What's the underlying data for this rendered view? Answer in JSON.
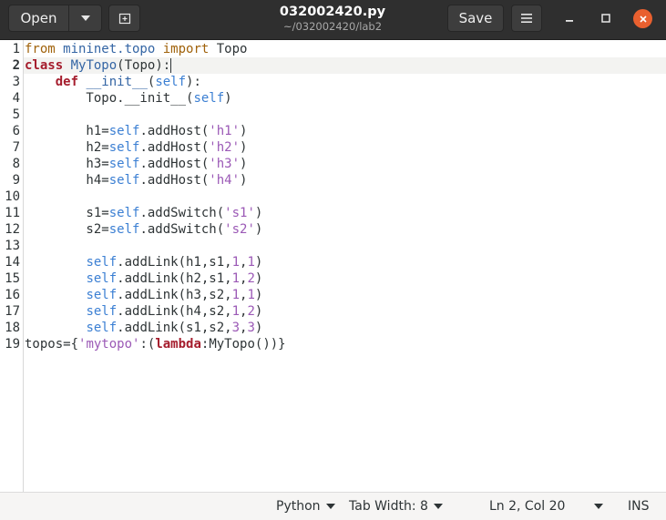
{
  "header": {
    "open_label": "Open",
    "save_label": "Save",
    "title": "032002420.py",
    "subtitle": "~/032002420/lab2"
  },
  "editor": {
    "lines": [
      {
        "n": "1",
        "tokens": [
          [
            "kw-imp",
            "from"
          ],
          [
            "",
            ""
          ],
          [
            "def-name",
            " mininet.topo"
          ],
          [
            "",
            ""
          ],
          [
            "kw-imp",
            " import"
          ],
          [
            "",
            " Topo"
          ]
        ]
      },
      {
        "n": "2",
        "tokens": [
          [
            "kw",
            "class"
          ],
          [
            "",
            " "
          ],
          [
            "def-name",
            "MyTopo"
          ],
          [
            "",
            "(Topo):"
          ]
        ]
      },
      {
        "n": "3",
        "tokens": [
          [
            "",
            "    "
          ],
          [
            "kw",
            "def"
          ],
          [
            "",
            " "
          ],
          [
            "def-name",
            "__init__"
          ],
          [
            "",
            "("
          ],
          [
            "self",
            "self"
          ],
          [
            "",
            "):"
          ]
        ]
      },
      {
        "n": "4",
        "tokens": [
          [
            "",
            "        Topo.__init__("
          ],
          [
            "self",
            "self"
          ],
          [
            "",
            ")"
          ]
        ]
      },
      {
        "n": "5",
        "tokens": []
      },
      {
        "n": "6",
        "tokens": [
          [
            "",
            "        h1="
          ],
          [
            "self",
            "self"
          ],
          [
            "",
            ".addHost("
          ],
          [
            "str",
            "'h1'"
          ],
          [
            "",
            ")"
          ]
        ]
      },
      {
        "n": "7",
        "tokens": [
          [
            "",
            "        h2="
          ],
          [
            "self",
            "self"
          ],
          [
            "",
            ".addHost("
          ],
          [
            "str",
            "'h2'"
          ],
          [
            "",
            ")"
          ]
        ]
      },
      {
        "n": "8",
        "tokens": [
          [
            "",
            "        h3="
          ],
          [
            "self",
            "self"
          ],
          [
            "",
            ".addHost("
          ],
          [
            "str",
            "'h3'"
          ],
          [
            "",
            ")"
          ]
        ]
      },
      {
        "n": "9",
        "tokens": [
          [
            "",
            "        h4="
          ],
          [
            "self",
            "self"
          ],
          [
            "",
            ".addHost("
          ],
          [
            "str",
            "'h4'"
          ],
          [
            "",
            ")"
          ]
        ]
      },
      {
        "n": "10",
        "tokens": []
      },
      {
        "n": "11",
        "tokens": [
          [
            "",
            "        s1="
          ],
          [
            "self",
            "self"
          ],
          [
            "",
            ".addSwitch("
          ],
          [
            "str",
            "'s1'"
          ],
          [
            "",
            ")"
          ]
        ]
      },
      {
        "n": "12",
        "tokens": [
          [
            "",
            "        s2="
          ],
          [
            "self",
            "self"
          ],
          [
            "",
            ".addSwitch("
          ],
          [
            "str",
            "'s2'"
          ],
          [
            "",
            ")"
          ]
        ]
      },
      {
        "n": "13",
        "tokens": []
      },
      {
        "n": "14",
        "tokens": [
          [
            "",
            "        "
          ],
          [
            "self",
            "self"
          ],
          [
            "",
            ".addLink(h1,s1,"
          ],
          [
            "num",
            "1"
          ],
          [
            "",
            ","
          ],
          [
            "num",
            "1"
          ],
          [
            "",
            ")"
          ]
        ]
      },
      {
        "n": "15",
        "tokens": [
          [
            "",
            "        "
          ],
          [
            "self",
            "self"
          ],
          [
            "",
            ".addLink(h2,s1,"
          ],
          [
            "num",
            "1"
          ],
          [
            "",
            ","
          ],
          [
            "num",
            "2"
          ],
          [
            "",
            ")"
          ]
        ]
      },
      {
        "n": "16",
        "tokens": [
          [
            "",
            "        "
          ],
          [
            "self",
            "self"
          ],
          [
            "",
            ".addLink(h3,s2,"
          ],
          [
            "num",
            "1"
          ],
          [
            "",
            ","
          ],
          [
            "num",
            "1"
          ],
          [
            "",
            ")"
          ]
        ]
      },
      {
        "n": "17",
        "tokens": [
          [
            "",
            "        "
          ],
          [
            "self",
            "self"
          ],
          [
            "",
            ".addLink(h4,s2,"
          ],
          [
            "num",
            "1"
          ],
          [
            "",
            ","
          ],
          [
            "num",
            "2"
          ],
          [
            "",
            ")"
          ]
        ]
      },
      {
        "n": "18",
        "tokens": [
          [
            "",
            "        "
          ],
          [
            "self",
            "self"
          ],
          [
            "",
            ".addLink(s1,s2,"
          ],
          [
            "num",
            "3"
          ],
          [
            "",
            ","
          ],
          [
            "num",
            "3"
          ],
          [
            "",
            ")"
          ]
        ]
      },
      {
        "n": "19",
        "tokens": [
          [
            "",
            "topos={"
          ],
          [
            "str",
            "'mytopo'"
          ],
          [
            "",
            ":("
          ],
          [
            "kw",
            "lambda"
          ],
          [
            "",
            ":MyTopo())}"
          ]
        ]
      }
    ],
    "current_line": "2"
  },
  "statusbar": {
    "language": "Python",
    "tab_width": "Tab Width: 8",
    "position": "Ln 2, Col 20",
    "mode": "INS"
  },
  "colors": {
    "accent_close": "#e9602f",
    "header_bg": "#2f2f2f"
  },
  "icons": [
    "chevron-down-icon",
    "new-tab-icon",
    "hamburger-menu-icon",
    "minimize-icon",
    "maximize-icon",
    "close-icon"
  ]
}
